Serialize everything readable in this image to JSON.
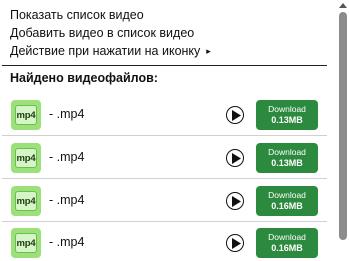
{
  "menu": {
    "show_list": "Показать список видео",
    "add_to_list": "Добавить видео в список видео",
    "icon_action": "Действие при нажатии на иконку",
    "submenu_arrow": "▸"
  },
  "found_title": "Найдено видеофайлов:",
  "videos": [
    {
      "thumb_label": "mp4",
      "name": "- .mp4",
      "download_label": "Download",
      "size": "0.13MB"
    },
    {
      "thumb_label": "mp4",
      "name": "- .mp4",
      "download_label": "Download",
      "size": "0.13MB"
    },
    {
      "thumb_label": "mp4",
      "name": "- .mp4",
      "download_label": "Download",
      "size": "0.16MB"
    },
    {
      "thumb_label": "mp4",
      "name": "- .mp4",
      "download_label": "Download",
      "size": "0.16MB"
    }
  ],
  "colors": {
    "download_button": "#2c8a3e",
    "thumbnail": "#9be07a"
  }
}
